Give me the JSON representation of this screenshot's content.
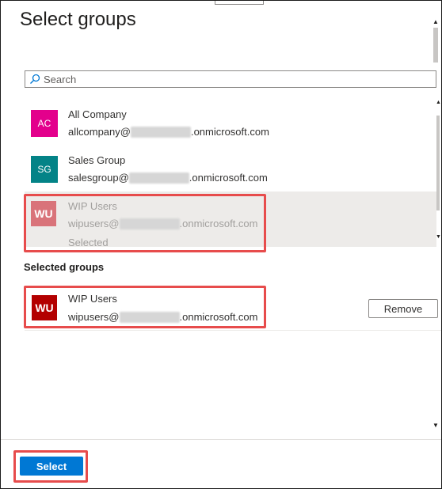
{
  "title": "Select groups",
  "search": {
    "placeholder": "Search"
  },
  "groups": [
    {
      "initials": "AC",
      "name": "All Company",
      "email_prefix": "allcompany@",
      "email_suffix": ".onmicrosoft.com",
      "color": "#e3008c",
      "status": ""
    },
    {
      "initials": "SG",
      "name": "Sales Group",
      "email_prefix": "salesgroup@",
      "email_suffix": ".onmicrosoft.com",
      "color": "#038387",
      "status": ""
    },
    {
      "initials": "WU",
      "name": "WIP Users",
      "email_prefix": "wipusers@",
      "email_suffix": ".onmicrosoft.com",
      "color": "#d9737a",
      "status": "Selected"
    }
  ],
  "selected_section": {
    "heading": "Selected groups",
    "items": [
      {
        "initials": "WU",
        "name": "WIP Users",
        "email_prefix": "wipusers@",
        "email_suffix": ".onmicrosoft.com",
        "color": "#b30000"
      }
    ],
    "remove_label": "Remove"
  },
  "footer": {
    "select_label": "Select"
  },
  "colors": {
    "accent": "#0078d4",
    "highlight": "#e74c4c"
  }
}
